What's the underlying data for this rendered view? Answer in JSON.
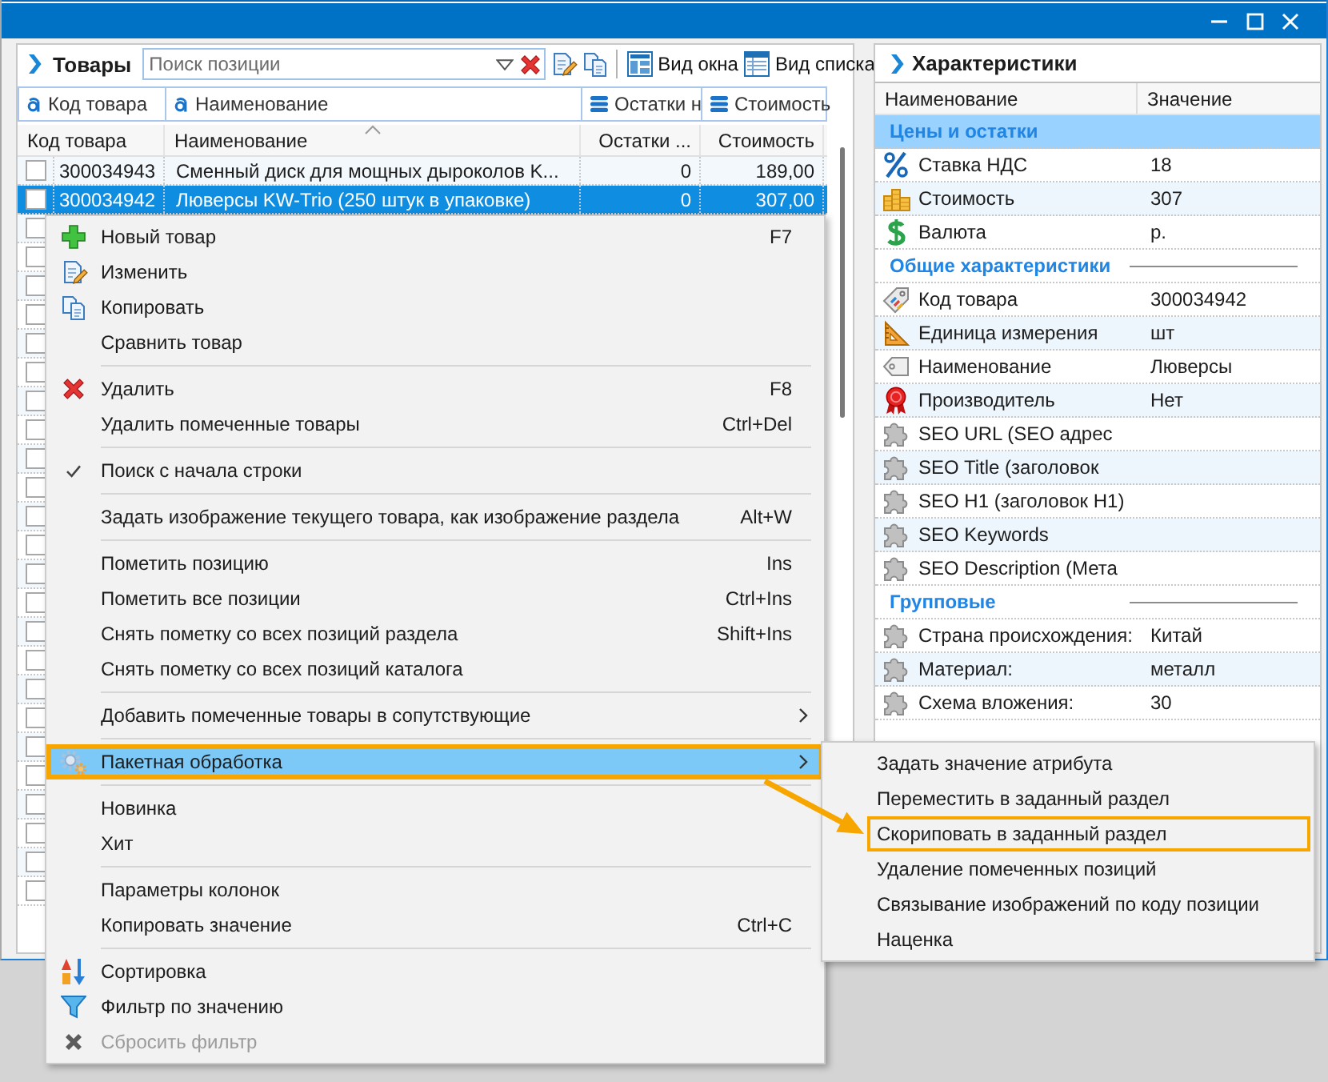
{
  "products": {
    "title": "Товары",
    "search": {
      "placeholder": "Поиск позиции"
    },
    "view_buttons": [
      "Вид окна",
      "Вид списка"
    ],
    "group_panel": [
      {
        "label": "Код товара",
        "kind": "text"
      },
      {
        "label": "Наименование",
        "kind": "text"
      },
      {
        "label": "Остатки н",
        "kind": "number"
      },
      {
        "label": "Стоимость",
        "kind": "number"
      }
    ],
    "columns": [
      {
        "label": "Код товара",
        "sorted": false
      },
      {
        "label": "Наименование",
        "sorted": true
      },
      {
        "label": "Остатки ...",
        "sorted": false
      },
      {
        "label": "Стоимость",
        "sorted": false
      }
    ],
    "rows": [
      {
        "checked": false,
        "selected": false,
        "cells": [
          "300034943",
          "Сменный диск для мощных дыроколов K...",
          "0",
          "189,00"
        ]
      },
      {
        "checked": false,
        "selected": true,
        "cells": [
          "300034942",
          "Люверсы KW-Trio (250 штук в упаковке)",
          "0",
          "307,00"
        ]
      },
      {
        "checked": false,
        "selected": false
      },
      {
        "checked": false,
        "selected": false
      },
      {
        "checked": false,
        "selected": false
      },
      {
        "checked": false,
        "selected": false
      },
      {
        "checked": false,
        "selected": false
      },
      {
        "checked": false,
        "selected": false
      },
      {
        "checked": false,
        "selected": false
      },
      {
        "checked": false,
        "selected": false
      },
      {
        "checked": false,
        "selected": false
      },
      {
        "checked": false,
        "selected": false
      },
      {
        "checked": false,
        "selected": false
      },
      {
        "checked": false,
        "selected": false
      },
      {
        "checked": false,
        "selected": false
      },
      {
        "checked": false,
        "selected": false
      },
      {
        "checked": false,
        "selected": false
      },
      {
        "checked": false,
        "selected": false
      },
      {
        "checked": false,
        "selected": false
      },
      {
        "checked": false,
        "selected": false
      },
      {
        "checked": false,
        "selected": false
      },
      {
        "checked": false,
        "selected": false
      },
      {
        "checked": false,
        "selected": false
      },
      {
        "checked": false,
        "selected": false
      },
      {
        "checked": false,
        "selected": false
      },
      {
        "checked": false,
        "selected": false
      }
    ]
  },
  "characteristics": {
    "title": "Характеристики",
    "columns": [
      "Наименование",
      "Значение"
    ],
    "groups": [
      {
        "title": "Цены и остатки",
        "selected": true,
        "rows": [
          {
            "name": "Ставка НДС",
            "value": "18",
            "selected": false
          },
          {
            "name": "Стоимость",
            "value": "307",
            "selected": false
          },
          {
            "name": "Валюта",
            "value": "р.",
            "selected": false
          }
        ]
      },
      {
        "title": "Общие характеристики",
        "selected": false,
        "rows": [
          {
            "name": "Код товара",
            "value": "300034942",
            "selected": false
          },
          {
            "name": "Единица измерения",
            "value": "шт",
            "selected": false
          },
          {
            "name": "Наименование",
            "value": "Люверсы",
            "selected": false
          },
          {
            "name": "Производитель",
            "value": "Нет",
            "selected": false
          },
          {
            "name": "SEO URL (SEO адрес",
            "selected": false
          },
          {
            "name": "SEO Title (заголовок",
            "selected": false
          },
          {
            "name": "SEO H1 (заголовок H1)",
            "selected": false
          },
          {
            "name": "SEO Keywords",
            "selected": false
          },
          {
            "name": "SEO Description (Мета",
            "selected": false
          }
        ]
      },
      {
        "title": "Групповые",
        "selected": false,
        "rows": [
          {
            "name": "Страна происхождения:",
            "value": "Китай",
            "selected": false
          },
          {
            "name": "Материал:",
            "value": "металл",
            "selected": false
          },
          {
            "name": "Схема вложения:",
            "value": "30",
            "selected": false
          }
        ]
      }
    ]
  },
  "context_menu": {
    "sections": [
      [
        {
          "label": "Новый товар",
          "shortcut": "F7",
          "selected": false,
          "checked": false,
          "disabled": false,
          "has_submenu": false,
          "marked": false
        },
        {
          "label": "Изменить",
          "selected": false,
          "checked": false,
          "disabled": false,
          "has_submenu": false,
          "marked": false
        },
        {
          "label": "Копировать",
          "selected": false,
          "checked": false,
          "disabled": false,
          "has_submenu": false,
          "marked": false
        },
        {
          "label": "Сравнить товар",
          "selected": false,
          "checked": false,
          "disabled": false,
          "has_submenu": false,
          "marked": false
        }
      ],
      [
        {
          "label": "Удалить",
          "shortcut": "F8",
          "selected": false,
          "checked": false,
          "disabled": false,
          "has_submenu": false,
          "marked": false
        },
        {
          "label": "Удалить помеченные товары",
          "shortcut": "Ctrl+Del",
          "selected": false,
          "checked": false,
          "disabled": false,
          "has_submenu": false,
          "marked": false
        }
      ],
      [
        {
          "label": "Поиск с начала строки",
          "selected": false,
          "checked": true,
          "disabled": false,
          "has_submenu": false,
          "marked": false
        }
      ],
      [
        {
          "label": "Задать изображение текущего товара, как изображение раздела",
          "shortcut": "Alt+W",
          "selected": false,
          "checked": false,
          "disabled": false,
          "has_submenu": false,
          "marked": false
        }
      ],
      [
        {
          "label": "Пометить позицию",
          "shortcut": "Ins",
          "selected": false,
          "checked": false,
          "disabled": false,
          "has_submenu": false,
          "marked": false
        },
        {
          "label": "Пометить все позиции",
          "shortcut": "Ctrl+Ins",
          "selected": false,
          "checked": false,
          "disabled": false,
          "has_submenu": false,
          "marked": false
        },
        {
          "label": "Снять пометку со всех позиций раздела",
          "shortcut": "Shift+Ins",
          "selected": false,
          "checked": false,
          "disabled": false,
          "has_submenu": false,
          "marked": false
        },
        {
          "label": "Снять пометку со всех позиций каталога",
          "selected": false,
          "checked": false,
          "disabled": false,
          "has_submenu": false,
          "marked": false
        }
      ],
      [
        {
          "label": "Добавить помеченные товары в сопутствующие",
          "selected": false,
          "checked": false,
          "disabled": false,
          "has_submenu": true,
          "marked": false
        }
      ],
      [
        {
          "label": "Пакетная обработка",
          "selected": true,
          "checked": false,
          "disabled": false,
          "has_submenu": true,
          "marked": true,
          "children": [
            {
              "label": "Задать значение атрибута",
              "selected": false,
              "marked": false
            },
            {
              "label": "Переместить в заданный раздел",
              "selected": false,
              "marked": false
            },
            {
              "label": "Скориповать в заданный раздел",
              "selected": false,
              "marked": true
            },
            {
              "label": "Удаление помеченных позиций",
              "selected": false,
              "marked": false
            },
            {
              "label": "Связывание изображений по коду позиции",
              "selected": false,
              "marked": false
            },
            {
              "label": "Наценка",
              "selected": false,
              "marked": false
            }
          ]
        }
      ],
      [
        {
          "label": "Новинка",
          "selected": false,
          "checked": false,
          "disabled": false,
          "has_submenu": false,
          "marked": false
        },
        {
          "label": "Хит",
          "selected": false,
          "checked": false,
          "disabled": false,
          "has_submenu": false,
          "marked": false
        }
      ],
      [
        {
          "label": "Параметры колонок",
          "selected": false,
          "checked": false,
          "disabled": false,
          "has_submenu": false,
          "marked": false
        },
        {
          "label": "Копировать значение",
          "shortcut": "Ctrl+C",
          "selected": false,
          "checked": false,
          "disabled": false,
          "has_submenu": false,
          "marked": false
        }
      ],
      [
        {
          "label": "Сортировка",
          "selected": false,
          "checked": false,
          "disabled": false,
          "has_submenu": false,
          "marked": false
        },
        {
          "label": "Фильтр по значению",
          "selected": false,
          "checked": false,
          "disabled": false,
          "has_submenu": false,
          "marked": false
        },
        {
          "label": "Сбросить фильтр",
          "selected": false,
          "checked": false,
          "disabled": true,
          "has_submenu": false,
          "marked": false
        }
      ]
    ]
  }
}
